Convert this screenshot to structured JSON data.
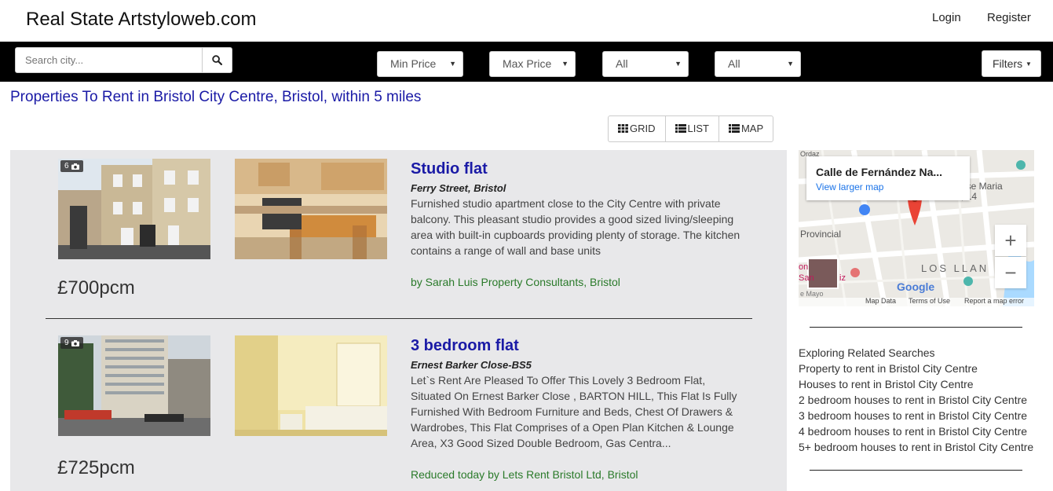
{
  "header": {
    "brand": "Real State Artstyloweb.com",
    "login": "Login",
    "register": "Register"
  },
  "search": {
    "placeholder": "Search city...",
    "min_price": "Min Price",
    "max_price": "Max Price",
    "select3": "All",
    "select4": "All",
    "filters": "Filters"
  },
  "page": {
    "title": "Properties To Rent in Bristol City Centre, Bristol, within 5 miles"
  },
  "view_toggle": {
    "grid": "GRID",
    "list": "LIST",
    "map": "MAP"
  },
  "listings": [
    {
      "photo_count": "6",
      "title": "Studio flat",
      "address": "Ferry Street, Bristol",
      "description": "Furnished studio apartment close to the City Centre with private balcony. This pleasant studio provides a good sized living/sleeping area with built-in cupboards providing plenty of storage. The kitchen contains a range of wall and base units",
      "agent": "by Sarah Luis Property Consultants, Bristol",
      "price": "£700pcm"
    },
    {
      "photo_count": "9",
      "title": "3 bedroom flat",
      "address": "Ernest Barker Close-BS5",
      "description": "Let`s Rent Are Pleased To Offer This Lovely 3 Bedroom Flat, Situated On Ernest Barker Close , BARTON HILL, This Flat Is Fully Furnished With Bedroom Furniture and Beds, Chest Of Drawers & Wardrobes, This Flat Comprises of a Open Plan Kitchen & Lounge Area, X3 Good Sized Double Bedroom, Gas Centra...",
      "agent": "Reduced today by Lets Rent Bristol Ltd, Bristol",
      "price": "£725pcm"
    }
  ],
  "map": {
    "place_title": "Calle de Fernández Na...",
    "larger_map": "View larger map",
    "label_provincial": "Provincial",
    "label_jose": "ose Maria",
    "label_14": ", 14",
    "label_los_llan": "LOS LLAN",
    "label_google": "Google",
    "label_mayo": "e Mayo",
    "label_ordaz": "Ordaz",
    "label_on": "on",
    "label_san": "San",
    "label_iz": "iz",
    "footer_data": "Map Data",
    "footer_terms": "Terms of Use",
    "footer_report": "Report a map error",
    "zoom_in": "+",
    "zoom_out": "−"
  },
  "related": {
    "heading": "Exploring Related Searches",
    "links": [
      "Property to rent in Bristol City Centre",
      "Houses to rent in Bristol City Centre",
      "2 bedroom houses to rent in Bristol City Centre",
      "3 bedroom houses to rent in Bristol City Centre",
      "4 bedroom houses to rent in Bristol City Centre",
      "5+ bedroom houses to rent in Bristol City Centre"
    ]
  }
}
